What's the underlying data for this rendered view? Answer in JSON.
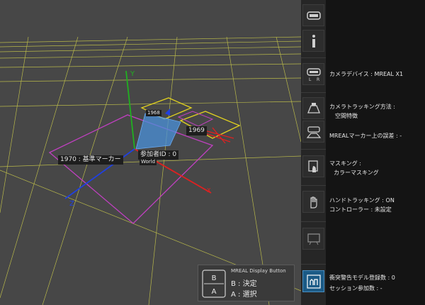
{
  "viewport": {
    "labels": {
      "y": "Y",
      "z": "Z",
      "x": "X",
      "marker_1970": "1970 : 基準マーカー",
      "marker_1969": "1969",
      "marker_1968": "1968",
      "participant": "参加者ID : 0",
      "world": "World"
    },
    "colors": {
      "background": "#474747",
      "grid": "#b8b84a",
      "x_axis": "#e02020",
      "y_axis": "#20b020",
      "z_axis": "#2040e0",
      "marker_frame": "#c040c0",
      "small_markers": "#e0d020",
      "camera": "#4a90d9"
    }
  },
  "display_button": {
    "title": "MREAL Display Button",
    "b_key": "B",
    "a_key": "A",
    "b_action": "B : 決定",
    "a_action": "A : 選択"
  },
  "sidebar": {
    "icons": [
      "headset-icon",
      "info-icon",
      "camera-device-icon",
      "camera-tracking-icon",
      "mreal-marker-icon",
      "masking-icon",
      "hand-tracking-icon",
      "video-icon",
      "collision-warning-icon"
    ],
    "camera_device": "カメラデバイス : MREAL X1",
    "tracking_method_label": "カメラトラッキング方法 :",
    "tracking_method_value": "空間特徴",
    "marker_error": "MREALマーカー上の誤差 : -",
    "masking_label": "マスキング :",
    "masking_value": "カラーマスキング",
    "hand_tracking": "ハンドトラッキング : ON",
    "controller": "コントローラー : 未設定",
    "collision_models": "衝突警告モデル登録数 : 0",
    "session_participants": "セッション参加数 : -"
  }
}
